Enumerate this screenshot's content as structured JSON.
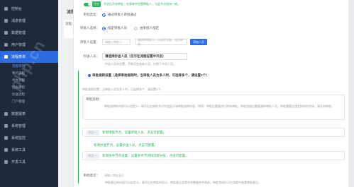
{
  "sidebar": {
    "items": [
      {
        "label": "控制台",
        "arrow": "›"
      },
      {
        "label": "消息管理",
        "arrow": "›"
      },
      {
        "label": "数据管理",
        "arrow": "›"
      },
      {
        "label": "用户管理",
        "arrow": "›"
      },
      {
        "label": "流程表单",
        "arrow": "∨"
      }
    ],
    "subitems": [
      "流程单列",
      "我的流程",
      "待办流程",
      "已办流程",
      "抄送流程",
      "门户管理"
    ],
    "items_after": [
      {
        "label": "数据报表",
        "arrow": "›"
      },
      {
        "label": "系统管理",
        "arrow": "›"
      },
      {
        "label": "系统监控",
        "arrow": "›"
      },
      {
        "label": "系统工具",
        "arrow": "›"
      },
      {
        "label": "开发工具",
        "arrow": "›"
      }
    ]
  },
  "background_page": {
    "title": "流程设计",
    "card_label": "流程"
  },
  "form": {
    "top_hint": "开启后开启审批，在表单中设置审批人，与此节点保持一致。",
    "toggle_tag": "开启",
    "approve_type_label": "审批类型：",
    "approve_type_option": "通过审批人审批通过",
    "approver_select_label": "审批人选择：",
    "approver_options": [
      "指定审批人员",
      "由审批人指定"
    ],
    "approver_setup_label": "审批人设置：",
    "approver_input1": "请输入审批人",
    "approver_input2": "请选择审批人，以逗号分割，也可单选",
    "approver_btn": "添加人员",
    "cc_label": "抄送人员：",
    "cc_select": "请选择抄送人员（仅可在流程设置中开启）",
    "cc_hint": "抄送人员的设置，不能设定具体人员，仅限于节点人员。",
    "rule_title": "审批规则设置（选择审批规则时，当审批人员为多人时，可选择多个，请设置1个）",
    "rule_hint": "审批规则设置：当审批人员为多人时，可选择多个，请设置1个。",
    "note_label": "审批说明：",
    "note_text": "审批说明的内容可以自定义，填写后在审批节点中会显示该审批说明内容，例如：审批后需要进行财务审批，审批完成后需要通知审批人员，审批需要在规定时间内完成，请及时审批。",
    "step1_pill": "节点 一",
    "step1_text": "新增审批节点，设置审批人员，点击可配置。",
    "step2_text": "新增抄送节点，设置抄送人员，点击可配置。",
    "step3_pill": "节点 一",
    "step3_text": "新增条件节点设置，设置条件节点和流程分支，点击可配置。",
    "footer_label": "审批意见：",
    "footer_placeholder": "请输入审批意见",
    "footer_hint": "审批意见的内容可以自定义，填写后在审批时显示，审批意见会提交到数据库中保存，审批完成后可在流程中查看审批意见。"
  },
  "watermark": "php.cn",
  "colors": {
    "sidebar_bg": "#1e2a3a",
    "accent": "#2d6cdf",
    "success": "#27b35a"
  }
}
